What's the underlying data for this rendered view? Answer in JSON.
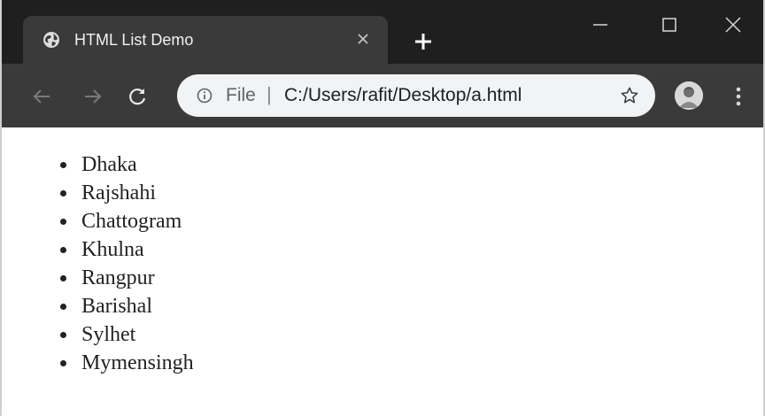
{
  "browser": {
    "tab": {
      "title": "HTML List Demo",
      "favicon": "globe-icon"
    },
    "window_controls": [
      "minimize-icon",
      "maximize-icon",
      "close-icon"
    ],
    "address_bar": {
      "scheme_label": "File",
      "separator": "|",
      "url": "C:/Users/rafit/Desktop/a.html"
    }
  },
  "page": {
    "list": [
      "Dhaka",
      "Rajshahi",
      "Chattogram",
      "Khulna",
      "Rangpur",
      "Barishal",
      "Sylhet",
      "Mymensingh"
    ]
  },
  "colors": {
    "titlebar": "#1f1f1f",
    "tab_and_toolbar": "#3a3a3a",
    "omnibox": "#f1f3f4",
    "page_text": "#222222"
  }
}
